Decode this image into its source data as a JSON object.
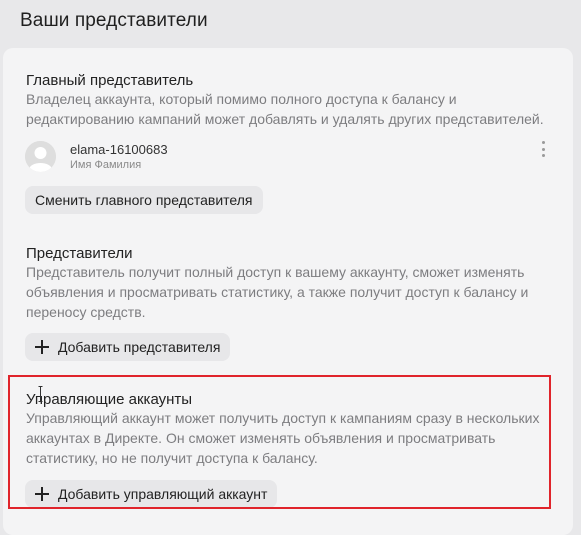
{
  "page": {
    "title": "Ваши представители"
  },
  "main_representative": {
    "title": "Главный представитель",
    "description": "Владелец аккаунта, который помимо полного доступа к балансу и редактированию кампаний может добавлять и удалять других представителей.",
    "user": {
      "login": "elama-16100683",
      "name": "Имя Фамилия"
    },
    "more_icon": "more-vertical-icon",
    "change_button": "Сменить главного представителя"
  },
  "representatives": {
    "title": "Представители",
    "description": "Представитель получит полный доступ к вашему аккаунту, сможет изменять объявления и просматривать статистику, а также получит доступ к балансу и переносу средств.",
    "add_button": "Добавить представителя"
  },
  "managing_accounts": {
    "title": "Управляющие аккаунты",
    "description": "Управляющий аккаунт может получить доступ к кампаниям сразу в нескольких аккаунтах в Директе. Он сможет изменять объявления и просматривать статистику, но не получит доступа к балансу.",
    "add_button": "Добавить управляющий аккаунт"
  },
  "colors": {
    "highlight": "#e0242b",
    "background": "#e8e8ea",
    "card": "#f4f4f5",
    "button": "#e7e7e9"
  }
}
